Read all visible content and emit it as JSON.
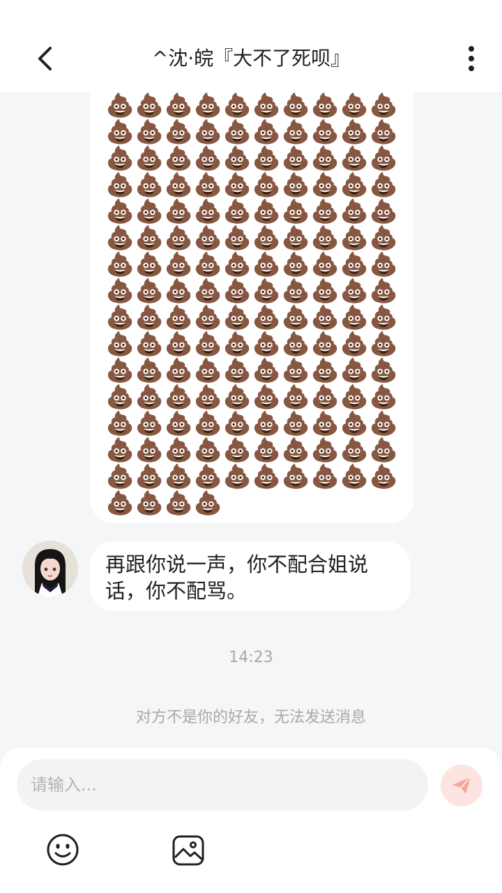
{
  "header": {
    "title": "^沈·皖『大不了死呗』"
  },
  "messages": {
    "emoji_message": {
      "emoji": "💩",
      "count": 154
    },
    "text_message": "再跟你说一声，你不配合姐说话，你不配骂。"
  },
  "time_label": "14:23",
  "notice": "对方不是你的好友，无法发送消息",
  "input": {
    "placeholder": "请输入..."
  },
  "icons": {
    "back": "back-arrow-icon",
    "more": "more-vertical-icon",
    "send": "paper-plane-icon",
    "emoji": "smiley-icon",
    "image": "image-icon"
  },
  "colors": {
    "background": "#f5f6f8",
    "bubble": "#ffffff",
    "send_button": "#fde4e0",
    "send_icon": "#f3a89a",
    "muted_text": "#a8a8a8"
  }
}
